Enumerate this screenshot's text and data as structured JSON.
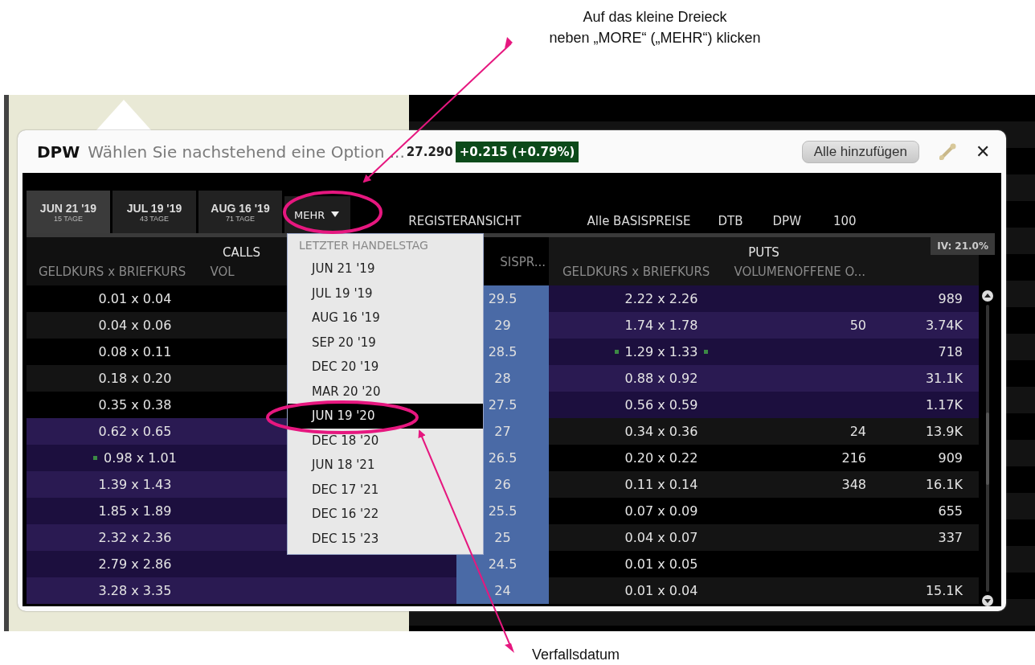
{
  "annotations": {
    "top": [
      "Auf das kleine Dreieck",
      "neben „MORE“ („MEHR“) klicken"
    ],
    "bottom": "Verfallsdatum"
  },
  "window": {
    "symbol": "DPW",
    "title": "Wählen Sie nachstehend eine Option ...",
    "price": "27.290",
    "change": "+0.215 (+0.79%)",
    "add_all_button": "Alle hinzufügen",
    "close": "✕"
  },
  "expiry_tabs": [
    {
      "date": "JUN 21 '19",
      "days": "15 TAGE",
      "selected": true
    },
    {
      "date": "JUL 19 '19",
      "days": "43 TAGE",
      "selected": false
    },
    {
      "date": "AUG 16 '19",
      "days": "71 TAGE",
      "selected": false
    }
  ],
  "more_button": {
    "label": "MEHR"
  },
  "info": [
    "REGISTERANSICHT",
    "Alle BASISPREISE",
    "DTB",
    "DPW",
    "100"
  ],
  "calls": {
    "title": "CALLS",
    "columns": [
      "GELDKURS x BRIEFKURS",
      "VOL"
    ]
  },
  "strike_header": "SISPR...",
  "puts": {
    "title": "PUTS",
    "iv": "IV: 21.0%",
    "columns": [
      "GELDKURS x BRIEFKURS",
      "VOLUMEN",
      "OFFENE O..."
    ]
  },
  "rows": [
    {
      "strike": "29.5",
      "call": {
        "quote": "0.01 x 0.04",
        "itm": false
      },
      "put": {
        "quote": "2.22 x 2.26",
        "open_interest": "989",
        "itm": true
      }
    },
    {
      "strike": "29",
      "call": {
        "quote": "0.04 x 0.06",
        "itm": false
      },
      "put": {
        "quote": "1.74 x 1.78",
        "volume": "50",
        "open_interest": "3.74K",
        "itm": true
      }
    },
    {
      "strike": "28.5",
      "call": {
        "quote": "0.08 x 0.11",
        "itm": false
      },
      "put": {
        "quote": "1.29 x 1.33",
        "open_interest": "718",
        "itm": true,
        "marker_left": true,
        "marker_right": true
      }
    },
    {
      "strike": "28",
      "call": {
        "quote": "0.18 x 0.20",
        "itm": false
      },
      "put": {
        "quote": "0.88 x 0.92",
        "open_interest": "31.1K",
        "itm": true
      }
    },
    {
      "strike": "27.5",
      "call": {
        "quote": "0.35 x 0.38",
        "itm": false
      },
      "put": {
        "quote": "0.56 x 0.59",
        "open_interest": "1.17K",
        "itm": true
      }
    },
    {
      "strike": "27",
      "call": {
        "quote": "0.62 x 0.65",
        "itm": true
      },
      "put": {
        "quote": "0.34 x 0.36",
        "volume": "24",
        "open_interest": "13.9K",
        "itm": false
      }
    },
    {
      "strike": "26.5",
      "call": {
        "quote": "0.98 x 1.01",
        "itm": true,
        "marker_left": true
      },
      "put": {
        "quote": "0.20 x 0.22",
        "volume": "216",
        "open_interest": "909",
        "itm": false
      }
    },
    {
      "strike": "26",
      "call": {
        "quote": "1.39 x 1.43",
        "itm": true
      },
      "put": {
        "quote": "0.11 x 0.14",
        "volume": "348",
        "open_interest": "16.1K",
        "itm": false
      }
    },
    {
      "strike": "25.5",
      "call": {
        "quote": "1.85 x 1.89",
        "itm": true
      },
      "put": {
        "quote": "0.07 x 0.09",
        "open_interest": "655",
        "itm": false
      }
    },
    {
      "strike": "25",
      "call": {
        "quote": "2.32 x 2.36",
        "itm": true
      },
      "put": {
        "quote": "0.04 x 0.07",
        "open_interest": "337",
        "itm": false
      }
    },
    {
      "strike": "24.5",
      "call": {
        "quote": "2.79 x 2.86",
        "itm": true
      },
      "put": {
        "quote": "0.01 x 0.05",
        "itm": false
      }
    },
    {
      "strike": "24",
      "call": {
        "quote": "3.28 x 3.35",
        "itm": true
      },
      "put": {
        "quote": "0.01 x 0.04",
        "open_interest": "15.1K",
        "itm": false
      }
    }
  ],
  "dropdown": {
    "header": "LETZTER HANDELSTAG",
    "items": [
      {
        "label": "JUN 21 '19",
        "selected": false
      },
      {
        "label": "JUL 19 '19",
        "selected": false
      },
      {
        "label": "AUG 16 '19",
        "selected": false
      },
      {
        "label": "SEP 20 '19",
        "selected": false
      },
      {
        "label": "DEC 20 '19",
        "selected": false
      },
      {
        "label": "MAR 20 '20",
        "selected": false
      },
      {
        "label": "JUN 19 '20",
        "selected": true
      },
      {
        "label": "DEC 18 '20",
        "selected": false
      },
      {
        "label": "JUN 18 '21",
        "selected": false
      },
      {
        "label": "DEC 17 '21",
        "selected": false
      },
      {
        "label": "DEC 16 '22",
        "selected": false
      },
      {
        "label": "DEC 15 '23",
        "selected": false
      }
    ]
  }
}
